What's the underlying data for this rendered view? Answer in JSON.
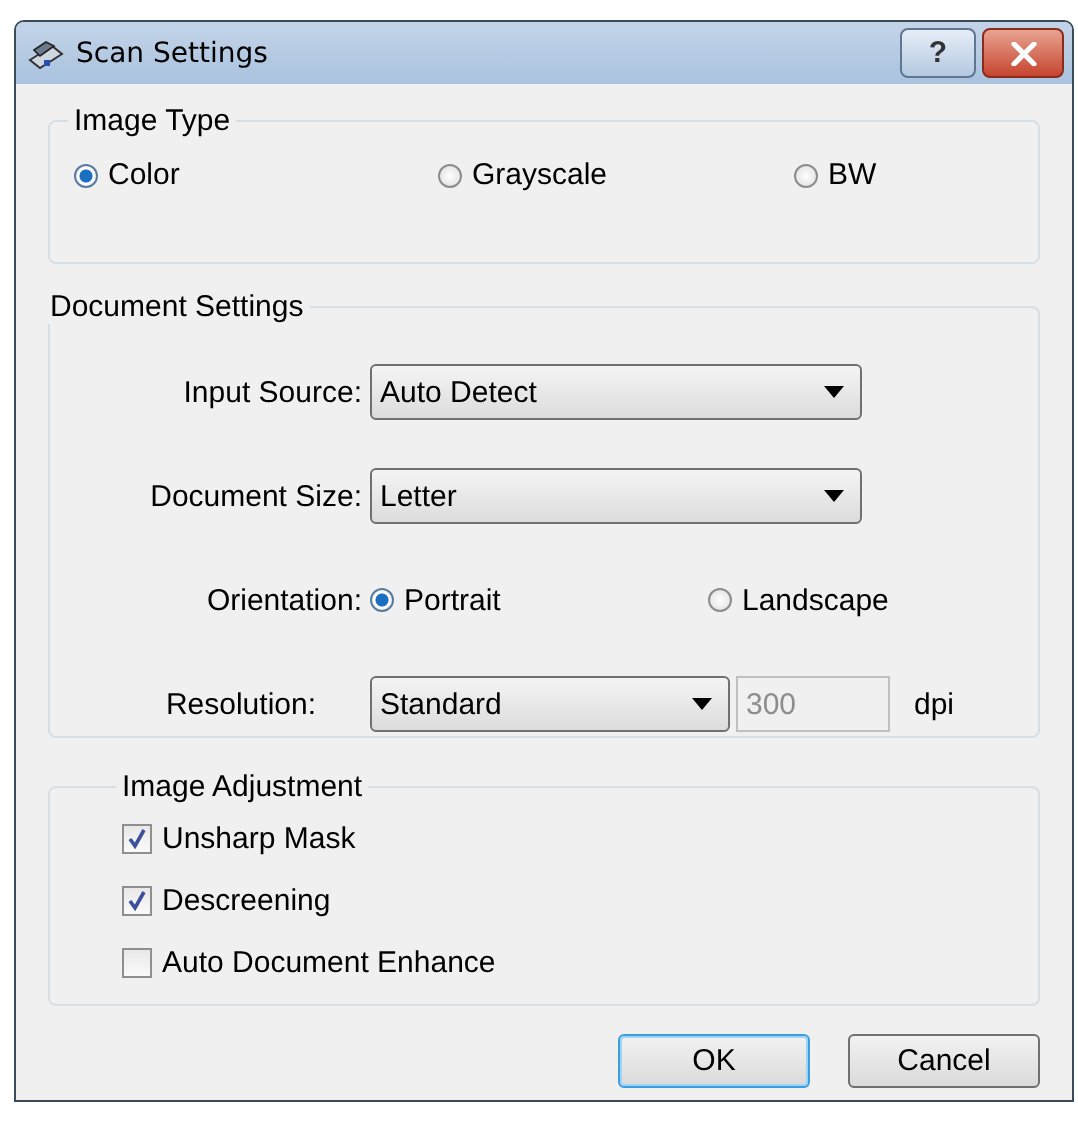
{
  "window": {
    "title": "Scan Settings",
    "help_button": "?"
  },
  "image_type": {
    "title": "Image Type",
    "options": [
      {
        "label": "Color",
        "selected": true
      },
      {
        "label": "Grayscale",
        "selected": false
      },
      {
        "label": "BW",
        "selected": false
      }
    ]
  },
  "document_settings": {
    "title": "Document Settings",
    "input_source": {
      "label": "Input Source:",
      "value": "Auto Detect"
    },
    "document_size": {
      "label": "Document Size:",
      "value": "Letter"
    },
    "orientation": {
      "label": "Orientation:",
      "options": [
        {
          "label": "Portrait",
          "selected": true
        },
        {
          "label": "Landscape",
          "selected": false
        }
      ]
    },
    "resolution": {
      "label": "Resolution:",
      "value": "Standard",
      "dpi_value": "300",
      "dpi_disabled": true,
      "unit": "dpi"
    }
  },
  "image_adjustment": {
    "title": "Image Adjustment",
    "options": [
      {
        "label": "Unsharp Mask",
        "checked": true
      },
      {
        "label": "Descreening",
        "checked": true
      },
      {
        "label": "Auto Document Enhance",
        "checked": false
      }
    ]
  },
  "buttons": [
    {
      "label": "OK",
      "default": true
    },
    {
      "label": "Cancel",
      "default": false
    }
  ]
}
